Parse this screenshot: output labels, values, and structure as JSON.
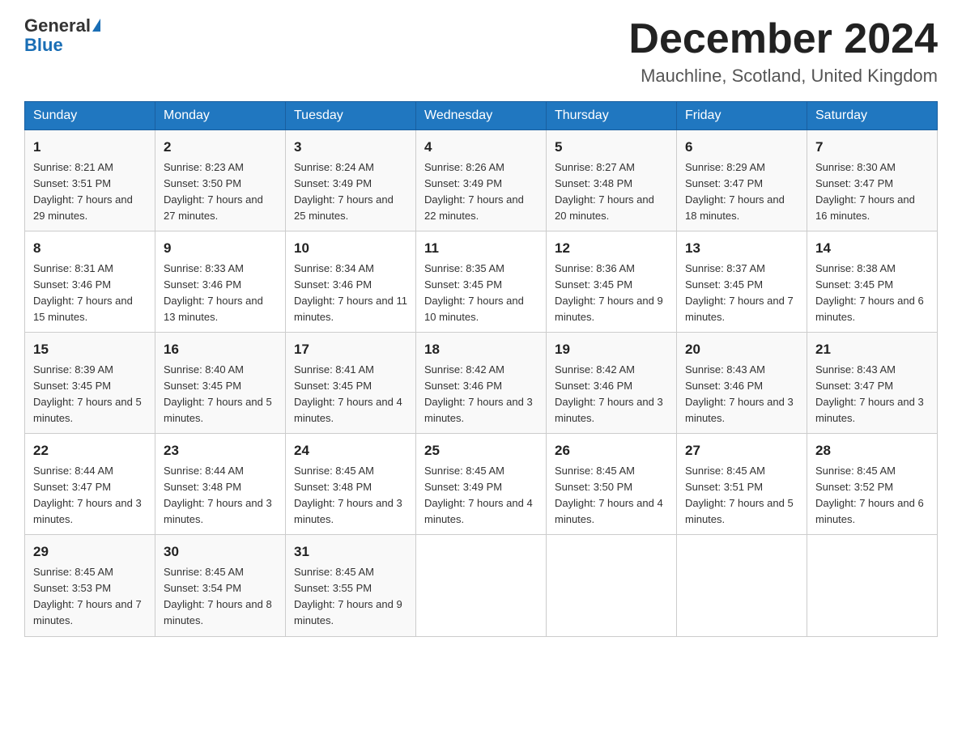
{
  "logo": {
    "text_general": "General",
    "text_blue": "Blue"
  },
  "header": {
    "month_year": "December 2024",
    "location": "Mauchline, Scotland, United Kingdom"
  },
  "weekdays": [
    "Sunday",
    "Monday",
    "Tuesday",
    "Wednesday",
    "Thursday",
    "Friday",
    "Saturday"
  ],
  "weeks": [
    [
      {
        "day": "1",
        "sunrise": "8:21 AM",
        "sunset": "3:51 PM",
        "daylight": "7 hours and 29 minutes."
      },
      {
        "day": "2",
        "sunrise": "8:23 AM",
        "sunset": "3:50 PM",
        "daylight": "7 hours and 27 minutes."
      },
      {
        "day": "3",
        "sunrise": "8:24 AM",
        "sunset": "3:49 PM",
        "daylight": "7 hours and 25 minutes."
      },
      {
        "day": "4",
        "sunrise": "8:26 AM",
        "sunset": "3:49 PM",
        "daylight": "7 hours and 22 minutes."
      },
      {
        "day": "5",
        "sunrise": "8:27 AM",
        "sunset": "3:48 PM",
        "daylight": "7 hours and 20 minutes."
      },
      {
        "day": "6",
        "sunrise": "8:29 AM",
        "sunset": "3:47 PM",
        "daylight": "7 hours and 18 minutes."
      },
      {
        "day": "7",
        "sunrise": "8:30 AM",
        "sunset": "3:47 PM",
        "daylight": "7 hours and 16 minutes."
      }
    ],
    [
      {
        "day": "8",
        "sunrise": "8:31 AM",
        "sunset": "3:46 PM",
        "daylight": "7 hours and 15 minutes."
      },
      {
        "day": "9",
        "sunrise": "8:33 AM",
        "sunset": "3:46 PM",
        "daylight": "7 hours and 13 minutes."
      },
      {
        "day": "10",
        "sunrise": "8:34 AM",
        "sunset": "3:46 PM",
        "daylight": "7 hours and 11 minutes."
      },
      {
        "day": "11",
        "sunrise": "8:35 AM",
        "sunset": "3:45 PM",
        "daylight": "7 hours and 10 minutes."
      },
      {
        "day": "12",
        "sunrise": "8:36 AM",
        "sunset": "3:45 PM",
        "daylight": "7 hours and 9 minutes."
      },
      {
        "day": "13",
        "sunrise": "8:37 AM",
        "sunset": "3:45 PM",
        "daylight": "7 hours and 7 minutes."
      },
      {
        "day": "14",
        "sunrise": "8:38 AM",
        "sunset": "3:45 PM",
        "daylight": "7 hours and 6 minutes."
      }
    ],
    [
      {
        "day": "15",
        "sunrise": "8:39 AM",
        "sunset": "3:45 PM",
        "daylight": "7 hours and 5 minutes."
      },
      {
        "day": "16",
        "sunrise": "8:40 AM",
        "sunset": "3:45 PM",
        "daylight": "7 hours and 5 minutes."
      },
      {
        "day": "17",
        "sunrise": "8:41 AM",
        "sunset": "3:45 PM",
        "daylight": "7 hours and 4 minutes."
      },
      {
        "day": "18",
        "sunrise": "8:42 AM",
        "sunset": "3:46 PM",
        "daylight": "7 hours and 3 minutes."
      },
      {
        "day": "19",
        "sunrise": "8:42 AM",
        "sunset": "3:46 PM",
        "daylight": "7 hours and 3 minutes."
      },
      {
        "day": "20",
        "sunrise": "8:43 AM",
        "sunset": "3:46 PM",
        "daylight": "7 hours and 3 minutes."
      },
      {
        "day": "21",
        "sunrise": "8:43 AM",
        "sunset": "3:47 PM",
        "daylight": "7 hours and 3 minutes."
      }
    ],
    [
      {
        "day": "22",
        "sunrise": "8:44 AM",
        "sunset": "3:47 PM",
        "daylight": "7 hours and 3 minutes."
      },
      {
        "day": "23",
        "sunrise": "8:44 AM",
        "sunset": "3:48 PM",
        "daylight": "7 hours and 3 minutes."
      },
      {
        "day": "24",
        "sunrise": "8:45 AM",
        "sunset": "3:48 PM",
        "daylight": "7 hours and 3 minutes."
      },
      {
        "day": "25",
        "sunrise": "8:45 AM",
        "sunset": "3:49 PM",
        "daylight": "7 hours and 4 minutes."
      },
      {
        "day": "26",
        "sunrise": "8:45 AM",
        "sunset": "3:50 PM",
        "daylight": "7 hours and 4 minutes."
      },
      {
        "day": "27",
        "sunrise": "8:45 AM",
        "sunset": "3:51 PM",
        "daylight": "7 hours and 5 minutes."
      },
      {
        "day": "28",
        "sunrise": "8:45 AM",
        "sunset": "3:52 PM",
        "daylight": "7 hours and 6 minutes."
      }
    ],
    [
      {
        "day": "29",
        "sunrise": "8:45 AM",
        "sunset": "3:53 PM",
        "daylight": "7 hours and 7 minutes."
      },
      {
        "day": "30",
        "sunrise": "8:45 AM",
        "sunset": "3:54 PM",
        "daylight": "7 hours and 8 minutes."
      },
      {
        "day": "31",
        "sunrise": "8:45 AM",
        "sunset": "3:55 PM",
        "daylight": "7 hours and 9 minutes."
      },
      null,
      null,
      null,
      null
    ]
  ]
}
